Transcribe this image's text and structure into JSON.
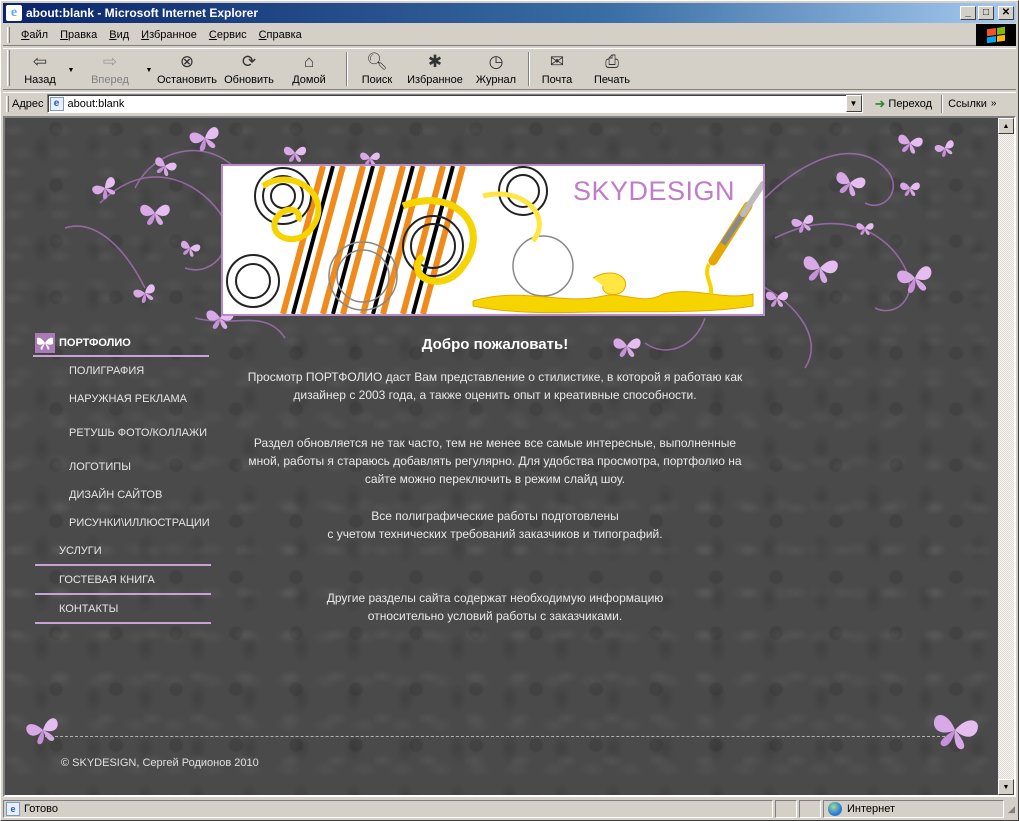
{
  "window": {
    "title": "about:blank - Microsoft Internet Explorer",
    "ie_icon": "e"
  },
  "menu": {
    "items": [
      {
        "key": "Ф",
        "rest": "айл"
      },
      {
        "key": "П",
        "rest": "равка"
      },
      {
        "key": "В",
        "rest": "ид"
      },
      {
        "key": "И",
        "rest": "збранное"
      },
      {
        "key": "С",
        "rest": "ервис"
      },
      {
        "key": "С",
        "rest": "правка"
      }
    ]
  },
  "toolbar": {
    "back": "Назад",
    "forward": "Вперед",
    "stop": "Остановить",
    "refresh": "Обновить",
    "home": "Домой",
    "search": "Поиск",
    "favorites": "Избранное",
    "history": "Журнал",
    "mail": "Почта",
    "print": "Печать"
  },
  "address": {
    "label": "Адрес",
    "value": "about:blank",
    "go": "Переход",
    "links": "Ссылки"
  },
  "site": {
    "brand": "SKYDESIGN",
    "nav": {
      "portfolio": "ПОРТФОЛИО",
      "sub": [
        "ПОЛИГРАФИЯ",
        "НАРУЖНАЯ РЕКЛАМА",
        "РЕТУШЬ ФОТО/КОЛЛАЖИ",
        "ЛОГОТИПЫ",
        "ДИЗАЙН САЙТОВ",
        "РИСУНКИ\\ИЛЛЮСТРАЦИИ"
      ],
      "main": [
        "УСЛУГИ",
        "ГОСТЕВАЯ КНИГА",
        "КОНТАКТЫ"
      ]
    },
    "heading": "Добро пожаловать!",
    "paragraphs": [
      "Просмотр ПОРТФОЛИО даст Вам представление о стилистике, в которой я работаю как дизайнер с 2003 года, а также оценить опыт и креативные способности.",
      "Раздел обновляется не так часто, тем не менее все самые интересные, выполненные мной, работы я стараюсь добавлять регулярно. Для удобства просмотра, портфолио на сайте можно переключить в режим слайд шоу.",
      "Все полиграфические работы подготовлены\nс учетом технических требований заказчиков и типографий.",
      "Другие разделы сайта содержат необходимую информацию\nотносительно условий работы с заказчиками."
    ],
    "footer": "© SKYDESIGN, Сергей Родионов 2010"
  },
  "status": {
    "text": "Готово",
    "zone": "Интернет"
  },
  "colors": {
    "accent": "#c07cc8",
    "butterfly": "#d9a8e6",
    "page_bg": "#4a4a4a"
  }
}
